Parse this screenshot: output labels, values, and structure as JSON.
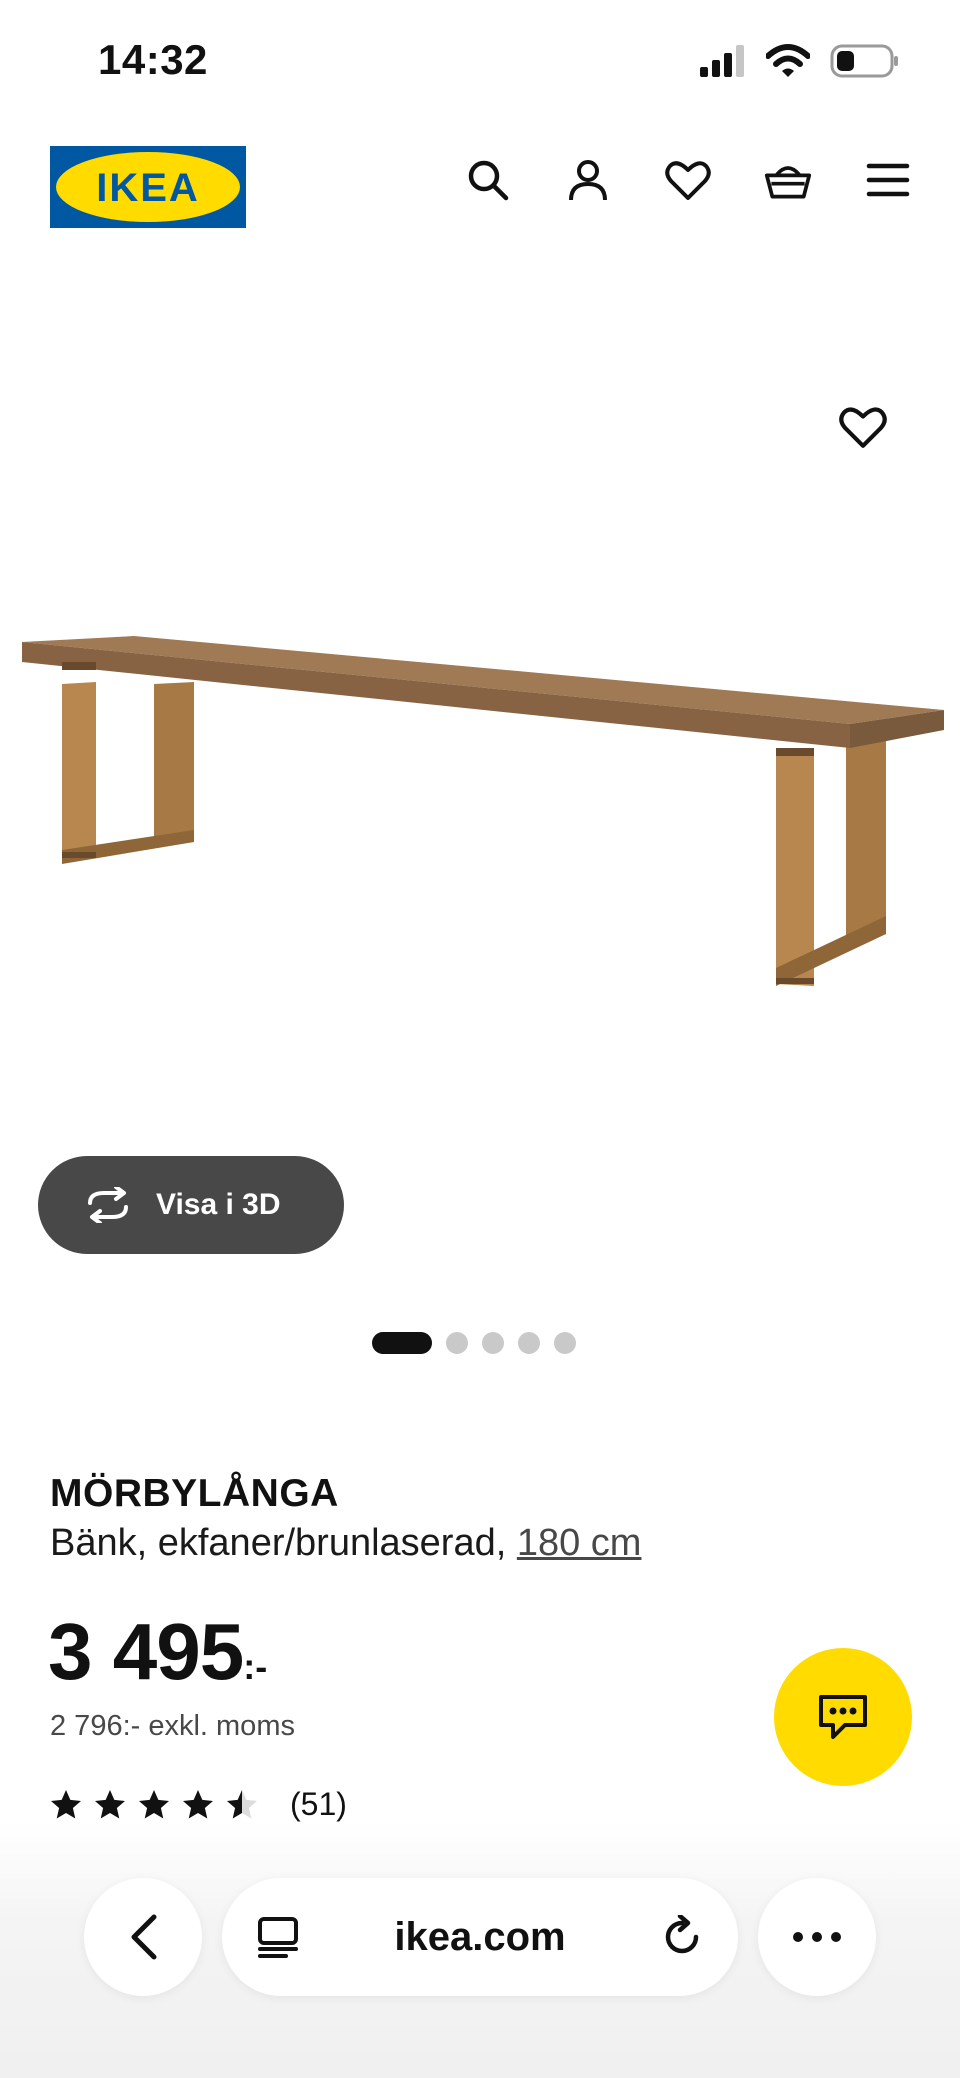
{
  "status_bar": {
    "time": "14:32"
  },
  "header": {
    "logo_text": "IKEA",
    "icons": [
      "search-icon",
      "account-icon",
      "heart-icon",
      "basket-icon",
      "menu-icon"
    ]
  },
  "product_image": {
    "view_3d_label": "Visa i 3D",
    "carousel_total": 5,
    "carousel_active": 1
  },
  "product": {
    "name": "MÖRBYLÅNGA",
    "description": "Bänk, ekfaner/brunlaserad, ",
    "size_link": "180 cm",
    "price_integer": "3 495",
    "price_suffix": ":-",
    "price_ex_vat": "2 796:- exkl. moms",
    "rating_value": 4.5,
    "rating_max": 5,
    "review_count": "(51)"
  },
  "browser_bar": {
    "url": "ikea.com"
  },
  "colors": {
    "brand_blue": "#0058a3",
    "brand_yellow": "#ffdb00",
    "dark_button": "#484848"
  }
}
